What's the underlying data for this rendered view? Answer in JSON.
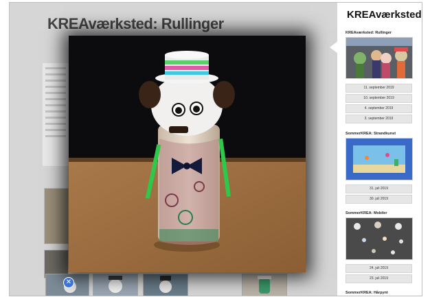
{
  "page": {
    "title": "KREAværksted: Rullinger"
  },
  "sidebar": {
    "site_title": "KREAværksted",
    "sections": [
      {
        "title": "KREAværksted: Rullinger",
        "dates": [
          "11. september 2019",
          "10. september 2019",
          "4. september 2019",
          "3. september 2019"
        ]
      },
      {
        "title": "SommerKREA: Strandkunst",
        "dates": [
          "31. juli 2019",
          "30. juli 2019"
        ]
      },
      {
        "title": "SommerKREA: Mobiler",
        "dates": [
          "24. juli 2019",
          "23. juli 2019"
        ]
      },
      {
        "title": "SommerKREA: Hårpynt",
        "dates": []
      }
    ]
  },
  "lightbox": {
    "close_icon": "close-icon",
    "close_glyph": "✕"
  },
  "colors": {
    "accent": "#3b73d8",
    "backdrop": "#d6d6d6"
  }
}
